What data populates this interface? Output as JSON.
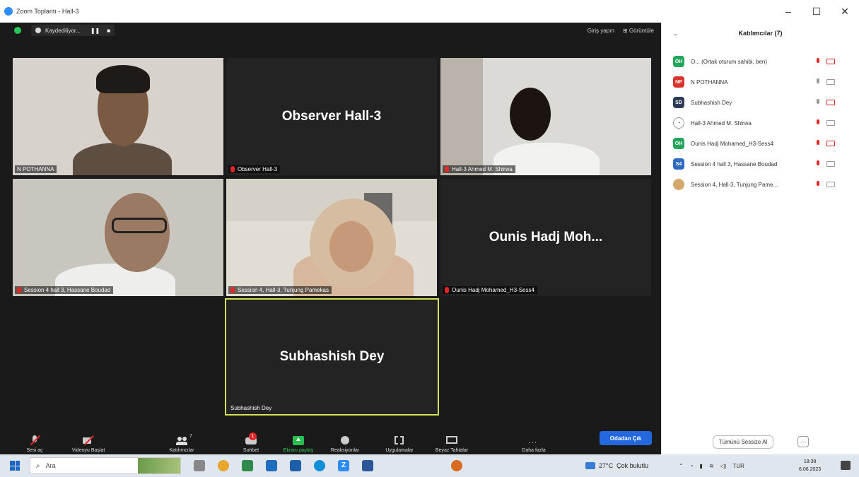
{
  "window": {
    "title": "Zoom Toplantı - Hall-3",
    "controls": [
      "–",
      "☐",
      "✕"
    ]
  },
  "topbar": {
    "recording_label": "Kaydediliyor...",
    "pause": "❚❚",
    "stop": "■",
    "sign_in": "Giriş yapın",
    "view": "Görüntüle"
  },
  "tiles": [
    {
      "name": "N POTHANNA"
    },
    {
      "name": "Observer Hall-3",
      "display_name": "Observer Hall-3"
    },
    {
      "name": "Hall-3 Ahmed M. Shirwa"
    },
    {
      "name": "Session 4 hall 3, Hassane Boudad"
    },
    {
      "name": "Session 4, Hall-3, Tunjung Pamekas"
    },
    {
      "name": "Ounis Hadj Mohamed_H3-Sess4",
      "display_name": "Ounis Hadj Moh..."
    },
    {
      "name": "Subhashish Dey",
      "display_name": "Subhashish Dey"
    }
  ],
  "toolbar": {
    "mute": "Sesi aç",
    "video": "Videoyu Başlat",
    "participants": "Katılımcılar",
    "participants_count": "7",
    "chat": "Sohbet",
    "chat_badge": "1",
    "share": "Ekranı paylaş",
    "reactions": "Reaksiyonlar",
    "apps": "Uygulamalar",
    "whiteboard": "Beyaz Tahtalar",
    "more": "Daha fazla",
    "leave": "Odadan Çık"
  },
  "panel": {
    "title": "Katılımcılar (7)",
    "participants": [
      {
        "initials": "OH",
        "name": "O... (Ortak oturum sahibi, ben)",
        "color": "#23a55a",
        "mic_muted": true,
        "cam_off": true
      },
      {
        "initials": "NP",
        "name": "N POTHANNA",
        "color": "#d9342b",
        "mic_muted": false,
        "cam_off": false
      },
      {
        "initials": "SD",
        "name": "Subhashish Dey",
        "color": "#2b3a55",
        "mic_muted": false,
        "cam_off": true
      },
      {
        "initials": "",
        "name": "Hall-3 Ahmed M. Shirwa",
        "color": "#ffffff",
        "mic_muted": true,
        "cam_off": false
      },
      {
        "initials": "OH",
        "name": "Ounis Hadj Mohamed_H3-Sess4",
        "color": "#23a55a",
        "mic_muted": true,
        "cam_off": true
      },
      {
        "initials": "S4",
        "name": "Session 4 hall 3, Hassane Boudad",
        "color": "#2d6cc0",
        "mic_muted": true,
        "cam_off": false
      },
      {
        "initials": "",
        "name": "Session 4, Hall-3, Tunjung Pame...",
        "color": "#d4a86a",
        "mic_muted": true,
        "cam_off": false
      }
    ],
    "mute_all": "Tümünü Sessize Al",
    "more": "···"
  },
  "taskbar": {
    "search_placeholder": "Ara",
    "temperature": "27°C",
    "weather": "Çok bulutlu",
    "lang": "TUR",
    "time": "18:38",
    "date": "6.06.2023"
  }
}
